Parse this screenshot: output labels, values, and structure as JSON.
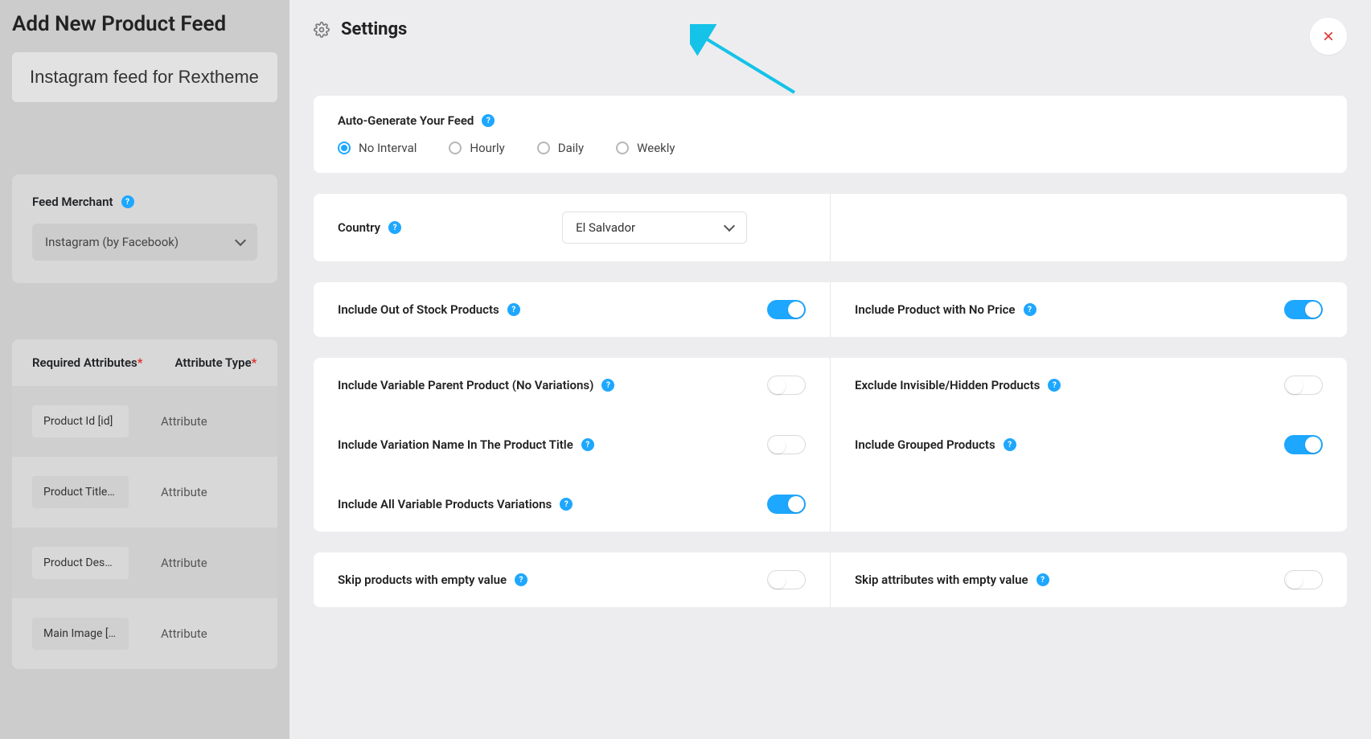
{
  "page": {
    "title": "Add New Product Feed",
    "feed_name": "Instagram feed for Rextheme"
  },
  "merchant": {
    "label": "Feed Merchant",
    "selected": "Instagram (by Facebook)"
  },
  "attributes": {
    "head_required": "Required Attributes",
    "head_type": "Attribute Type",
    "rows": [
      {
        "tag": "Product Id [id]",
        "type": "Attribute"
      },
      {
        "tag": "Product Title …",
        "type": "Attribute"
      },
      {
        "tag": "Product Desc…",
        "type": "Attribute"
      },
      {
        "tag": "Main Image […",
        "type": "Attribute"
      }
    ]
  },
  "settings": {
    "title": "Settings",
    "auto_gen": {
      "label": "Auto-Generate Your Feed",
      "options": [
        "No Interval",
        "Hourly",
        "Daily",
        "Weekly"
      ],
      "selected": "No Interval"
    },
    "country": {
      "label": "Country",
      "value": "El Salvador"
    },
    "toggles": {
      "out_of_stock": {
        "label": "Include Out of Stock Products",
        "on": true
      },
      "no_price": {
        "label": "Include Product with No Price",
        "on": true
      },
      "var_parent": {
        "label": "Include Variable Parent Product (No Variations)",
        "on": false
      },
      "exclude_hidden": {
        "label": "Exclude Invisible/Hidden Products",
        "on": false
      },
      "var_name_title": {
        "label": "Include Variation Name In The Product Title",
        "on": false
      },
      "grouped": {
        "label": "Include Grouped Products",
        "on": true
      },
      "all_var": {
        "label": "Include All Variable Products Variations",
        "on": true
      },
      "skip_prod_empty": {
        "label": "Skip products with empty value",
        "on": false
      },
      "skip_attr_empty": {
        "label": "Skip attributes with empty value",
        "on": false
      }
    }
  }
}
